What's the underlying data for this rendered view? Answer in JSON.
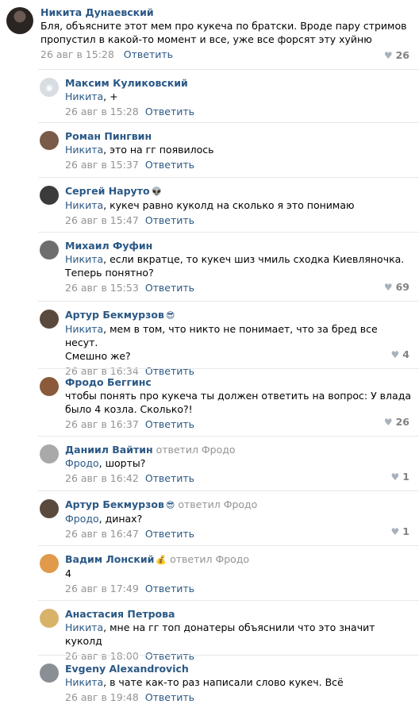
{
  "top_comment": {
    "author": "Никита Дунаевский",
    "text": "Бля, объясните этот мем про кукеча по братски. Вроде пару стримов\nпропустил в какой-то момент и все, уже все форсят эту хуйню",
    "date": "26 авг в 15:28",
    "reply_label": "Ответить",
    "likes": "26"
  },
  "replies": [
    {
      "author": "Максим Куликовский",
      "emoji": "",
      "reply_to": "",
      "mention": "Никита",
      "text": ", +",
      "date": "26 авг в 15:28",
      "reply_label": "Ответить",
      "likes": "",
      "avatar_color": "#d7dde3"
    },
    {
      "author": "Роман Пингвин",
      "emoji": "",
      "reply_to": "",
      "mention": "Никита",
      "text": ", это на гг появилось",
      "date": "26 авг в 15:37",
      "reply_label": "Ответить",
      "likes": "",
      "avatar_color": "#7a5a48"
    },
    {
      "author": "Сергей Наруто",
      "emoji": "👽",
      "reply_to": "",
      "mention": "Никита",
      "text": ", кукеч равно куколд на сколько я это понимаю",
      "date": "26 авг в 15:47",
      "reply_label": "Ответить",
      "likes": "",
      "avatar_color": "#3b3b3b"
    },
    {
      "author": "Михаил Фуфин",
      "emoji": "",
      "reply_to": "",
      "mention": "Никита",
      "text": ", если вкратце, то кукеч шиз чмиль сходка Киевляночка.\nТеперь понятно?",
      "date": "26 авг в 15:53",
      "reply_label": "Ответить",
      "likes": "69",
      "avatar_color": "#6e6e6e"
    },
    {
      "author": "Артур Бекмурзов",
      "emoji": "😎",
      "reply_to": "",
      "mention": "Никита",
      "text": ", мем в том, что никто не понимает, что за бред все несут.\nСмешно же?",
      "date": "26 авг в 16:34",
      "reply_label": "Ответить",
      "likes": "4",
      "avatar_color": "#5a4a3e"
    },
    {
      "author": "Фродо Беггинс",
      "emoji": "",
      "reply_to": "",
      "mention": "",
      "text": "чтобы понять про кукеча ты должен ответить на вопрос: У влада\nбыло 4 козла. Сколько?!",
      "date": "26 авг в 16:37",
      "reply_label": "Ответить",
      "likes": "26",
      "avatar_color": "#8a5a3a"
    },
    {
      "author": "Даниил Вайтин",
      "emoji": "",
      "reply_to": "ответил Фродо",
      "mention": "Фродо",
      "text": ", шорты?",
      "date": "26 авг в 16:42",
      "reply_label": "Ответить",
      "likes": "1",
      "avatar_color": "#a9a9a9"
    },
    {
      "author": "Артур Бекмурзов",
      "emoji": "😎",
      "reply_to": "ответил Фродо",
      "mention": "Фродо",
      "text": ", динах?",
      "date": "26 авг в 16:47",
      "reply_label": "Ответить",
      "likes": "1",
      "avatar_color": "#5a4a3e"
    },
    {
      "author": "Вадим Лонский",
      "emoji": "💰",
      "reply_to": "ответил Фродо",
      "mention": "",
      "text": "4",
      "date": "26 авг в 17:49",
      "reply_label": "Ответить",
      "likes": "",
      "avatar_color": "#e09a4a"
    },
    {
      "author": "Анастасия Петрова",
      "emoji": "",
      "reply_to": "",
      "mention": "Никита",
      "text": ", мне на гг топ донатеры объяснили что это значит куколд",
      "date": "26 авг в 18:00",
      "reply_label": "Ответить",
      "likes": "",
      "avatar_color": "#d9b26a"
    },
    {
      "author": "Evgeny Alexandrovich",
      "emoji": "",
      "reply_to": "",
      "mention": "Никита",
      "text": ", в чате как-то раз написали слово кукеч. Всё",
      "date": "26 авг в 19:48",
      "reply_label": "Ответить",
      "likes": "",
      "avatar_color": "#8a8f95"
    }
  ],
  "icons": {
    "like": "heart-icon",
    "placeholder_avatar": "camera-icon"
  }
}
